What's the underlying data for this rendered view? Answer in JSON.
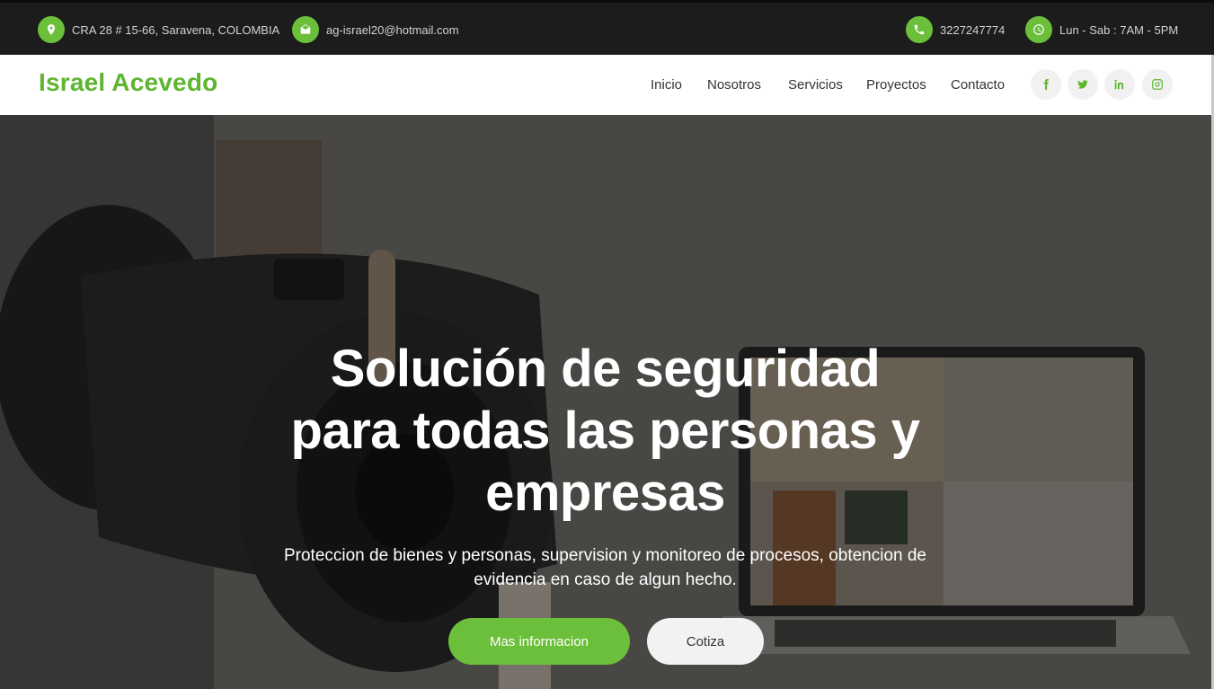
{
  "topbar": {
    "address": "CRA 28 # 15-66, Saravena, COLOMBIA",
    "email": "ag-israel20@hotmail.com",
    "phone": "3227247774",
    "hours": "Lun - Sab : 7AM - 5PM",
    "icons": [
      "map-pin-icon",
      "envelope-icon",
      "phone-icon",
      "clock-icon"
    ]
  },
  "header": {
    "brand": "Israel Acevedo",
    "nav": [
      "Inicio",
      "Nosotros",
      "Servicios",
      "Proyectos",
      "Contacto"
    ],
    "social_icons": [
      "facebook-icon",
      "twitter-icon",
      "linkedin-icon",
      "instagram-icon"
    ]
  },
  "hero": {
    "title": "Solución de seguridad para todas las personas y empresas",
    "subtitle": "Proteccion de bienes y personas, supervision y monitoreo de procesos, obtencion de evidencia en caso de algun hecho.",
    "primary_button": "Mas informacion",
    "secondary_button": "Cotiza"
  },
  "colors": {
    "accent": "#6cbf3b",
    "brand": "#5db530",
    "topbar_bg": "#1c1c1c"
  }
}
